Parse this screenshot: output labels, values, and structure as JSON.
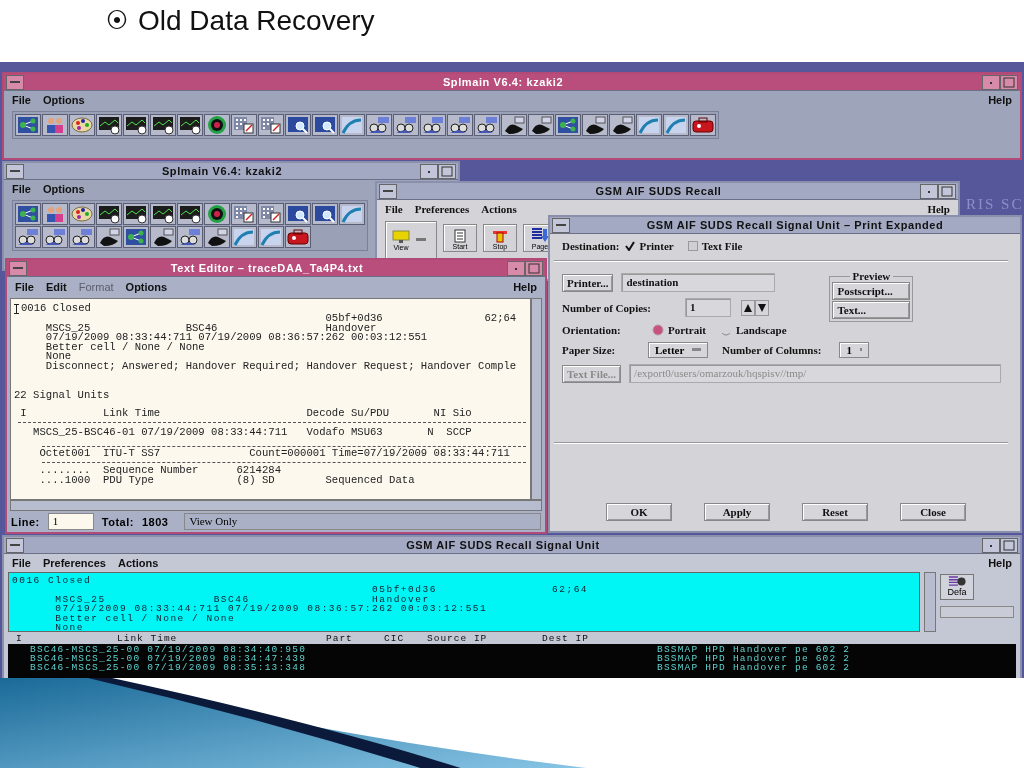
{
  "slide": {
    "bullet": "⦿",
    "title": "Old Data Recovery"
  },
  "wallpaper_text": "RIS SC",
  "main_window": {
    "title": "Splmain V6.4: kzaki2",
    "active": true,
    "menus": [
      "File",
      "Options"
    ],
    "help": "Help"
  },
  "second_window": {
    "title": "Splmain V6.4: kzaki2",
    "active": false,
    "menus": [
      "File",
      "Options"
    ]
  },
  "recall_window": {
    "title": "GSM AIF SUDS Recall",
    "active": false,
    "menus": [
      "File",
      "Preferences",
      "Actions"
    ],
    "help": "Help",
    "tools": [
      {
        "kind": "view",
        "label": "View"
      },
      {
        "kind": "start",
        "label": "Start"
      },
      {
        "kind": "stop",
        "label": "Stop"
      },
      {
        "kind": "page",
        "label": "Page"
      }
    ]
  },
  "text_editor": {
    "title": "Text Editor – traceDAA_Ta4P4.txt",
    "active": true,
    "menus": [
      {
        "label": "File",
        "disabled": false
      },
      {
        "label": "Edit",
        "disabled": false
      },
      {
        "label": "Format",
        "disabled": true
      },
      {
        "label": "Options",
        "disabled": false
      }
    ],
    "help": "Help",
    "record": [
      "0016 Closed",
      "                                                 05bf+0d36                62;64",
      "     MSCS_25               BSC46                 Handover",
      "     07/19/2009 08:33:44:711 07/19/2009 08:36:57:262 00:03:12:551",
      "     Better cell / None / None",
      "     None",
      "     Disconnect; Answered; Handover Required; Handover Request; Handover Comple"
    ],
    "summary": "22 Signal Units",
    "table_header": " I            Link Time                       Decode Su/PDU       NI Sio",
    "unit_row": "   MSCS_25-BSC46-01 07/19/2009 08:33:44:711   Vodafo MSU63       N  SCCP",
    "octet_row": "    Octet001  ITU-T SS7              Count=000001 Time=07/19/2009 08:33:44:711",
    "detail_rows": [
      "    ........  Sequence Number      6214284",
      "    ....1000  PDU Type             (8) SD        Sequenced Data"
    ],
    "line_label": "Line:",
    "line_value": "1",
    "total_label": "Total:",
    "total_value": "1803",
    "status": "View Only"
  },
  "print_dialog": {
    "title": "GSM AIF SUDS Recall Signal Unit – Print Expanded",
    "destination_label": "Destination:",
    "destinations": [
      {
        "label": "Printer",
        "checked": true
      },
      {
        "label": "Text File",
        "checked": false
      }
    ],
    "printer_button": "Printer...",
    "printer_value": "destination",
    "copies_label": "Number of Copies:",
    "copies_value": "1",
    "preview_label": "Preview",
    "preview_buttons": [
      "Postscript...",
      "Text..."
    ],
    "orientation_label": "Orientation:",
    "orientations": [
      {
        "label": "Portrait",
        "selected": true
      },
      {
        "label": "Landscape",
        "selected": false
      }
    ],
    "paper_label": "Paper Size:",
    "paper_value": "Letter",
    "columns_label": "Number of Columns:",
    "columns_value": "1",
    "text_file_button": {
      "label": "Text File...",
      "disabled": true
    },
    "path": {
      "value": "/export0/users/omarzouk/hqspisv//tmp/",
      "disabled": true
    },
    "buttons": [
      "OK",
      "Apply",
      "Reset",
      "Close"
    ]
  },
  "signal_unit_window": {
    "title": "GSM AIF SUDS Recall Signal Unit",
    "active": false,
    "menus": [
      "File",
      "Preferences",
      "Actions"
    ],
    "help": "Help",
    "record": [
      "0016 Closed",
      "                                                  05bf+0d36                62;64",
      "      MSCS_25               BSC46                 Handover",
      "      07/19/2009 08:33:44:711 07/19/2009 08:36:57:262 00:03:12:551",
      "      Better cell / None / None",
      "      None"
    ],
    "side_button": "Defa",
    "columns": [
      "I",
      "Link Time",
      "Part",
      "CIC",
      "Source IP",
      "Dest IP"
    ],
    "rows": [
      {
        "link": "BSC46-MSCS_25-00 07/19/2009 08:34:40:950",
        "decode": "BSSMAP HPD Handover pe 602 2"
      },
      {
        "link": "BSC46-MSCS_25-00 07/19/2009 08:34:47:439",
        "decode": "BSSMAP HPD Handover pe 602 2"
      },
      {
        "link": "BSC46-MSCS_25-00 07/19/2009 08:35:13:348",
        "decode": "BSSMAP HPD Handover pe 602 2"
      }
    ]
  }
}
